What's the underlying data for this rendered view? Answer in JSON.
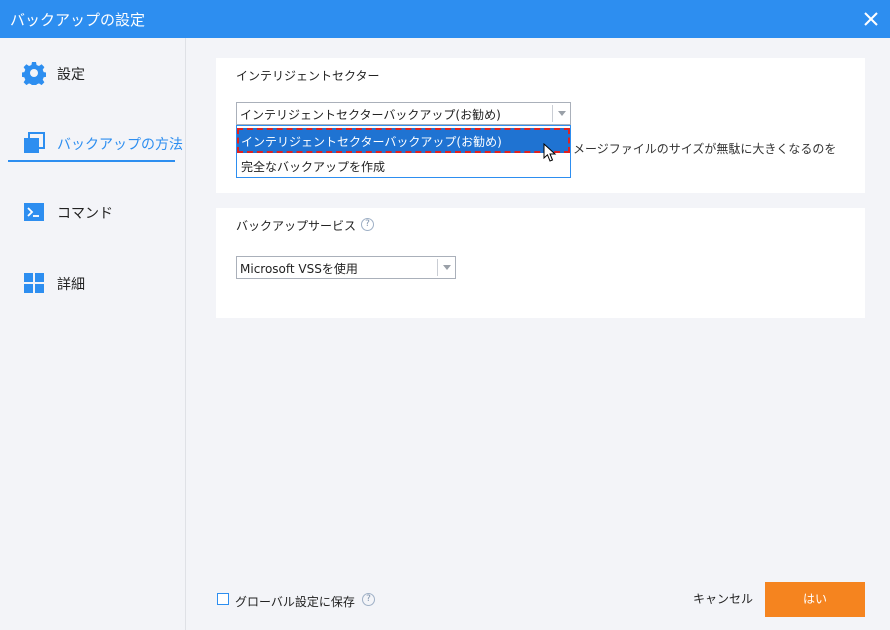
{
  "window": {
    "title": "バックアップの設定"
  },
  "sidebar": {
    "items": [
      {
        "label": "設定",
        "icon": "gear-icon"
      },
      {
        "label": "バックアップの方法",
        "icon": "copy-icon",
        "active": true
      },
      {
        "label": "コマンド",
        "icon": "terminal-icon"
      },
      {
        "label": "詳細",
        "icon": "grid-icon"
      }
    ]
  },
  "intelligent_section": {
    "title": "インテリジェントセクター",
    "combo_value": "インテリジェントセクターバックアップ(お勧め)",
    "dropdown_options": [
      "インテリジェントセクターバックアップ(お勧め)",
      "完全なバックアップを作成"
    ],
    "selected_index": 0,
    "description_partial": "メージファイルのサイズが無駄に大きくなるのを"
  },
  "backup_service_section": {
    "title": "バックアップサービス",
    "help": "?",
    "combo_value": "Microsoft VSSを使用"
  },
  "footer": {
    "save_global_label": "グローバル設定に保存",
    "save_global_checked": false,
    "help": "?",
    "cancel_label": "キャンセル",
    "ok_label": "はい"
  },
  "colors": {
    "accent": "#2d8ef0",
    "ok_button": "#f5841f",
    "selection": "#1f73d2",
    "highlight_border": "#e02020"
  }
}
